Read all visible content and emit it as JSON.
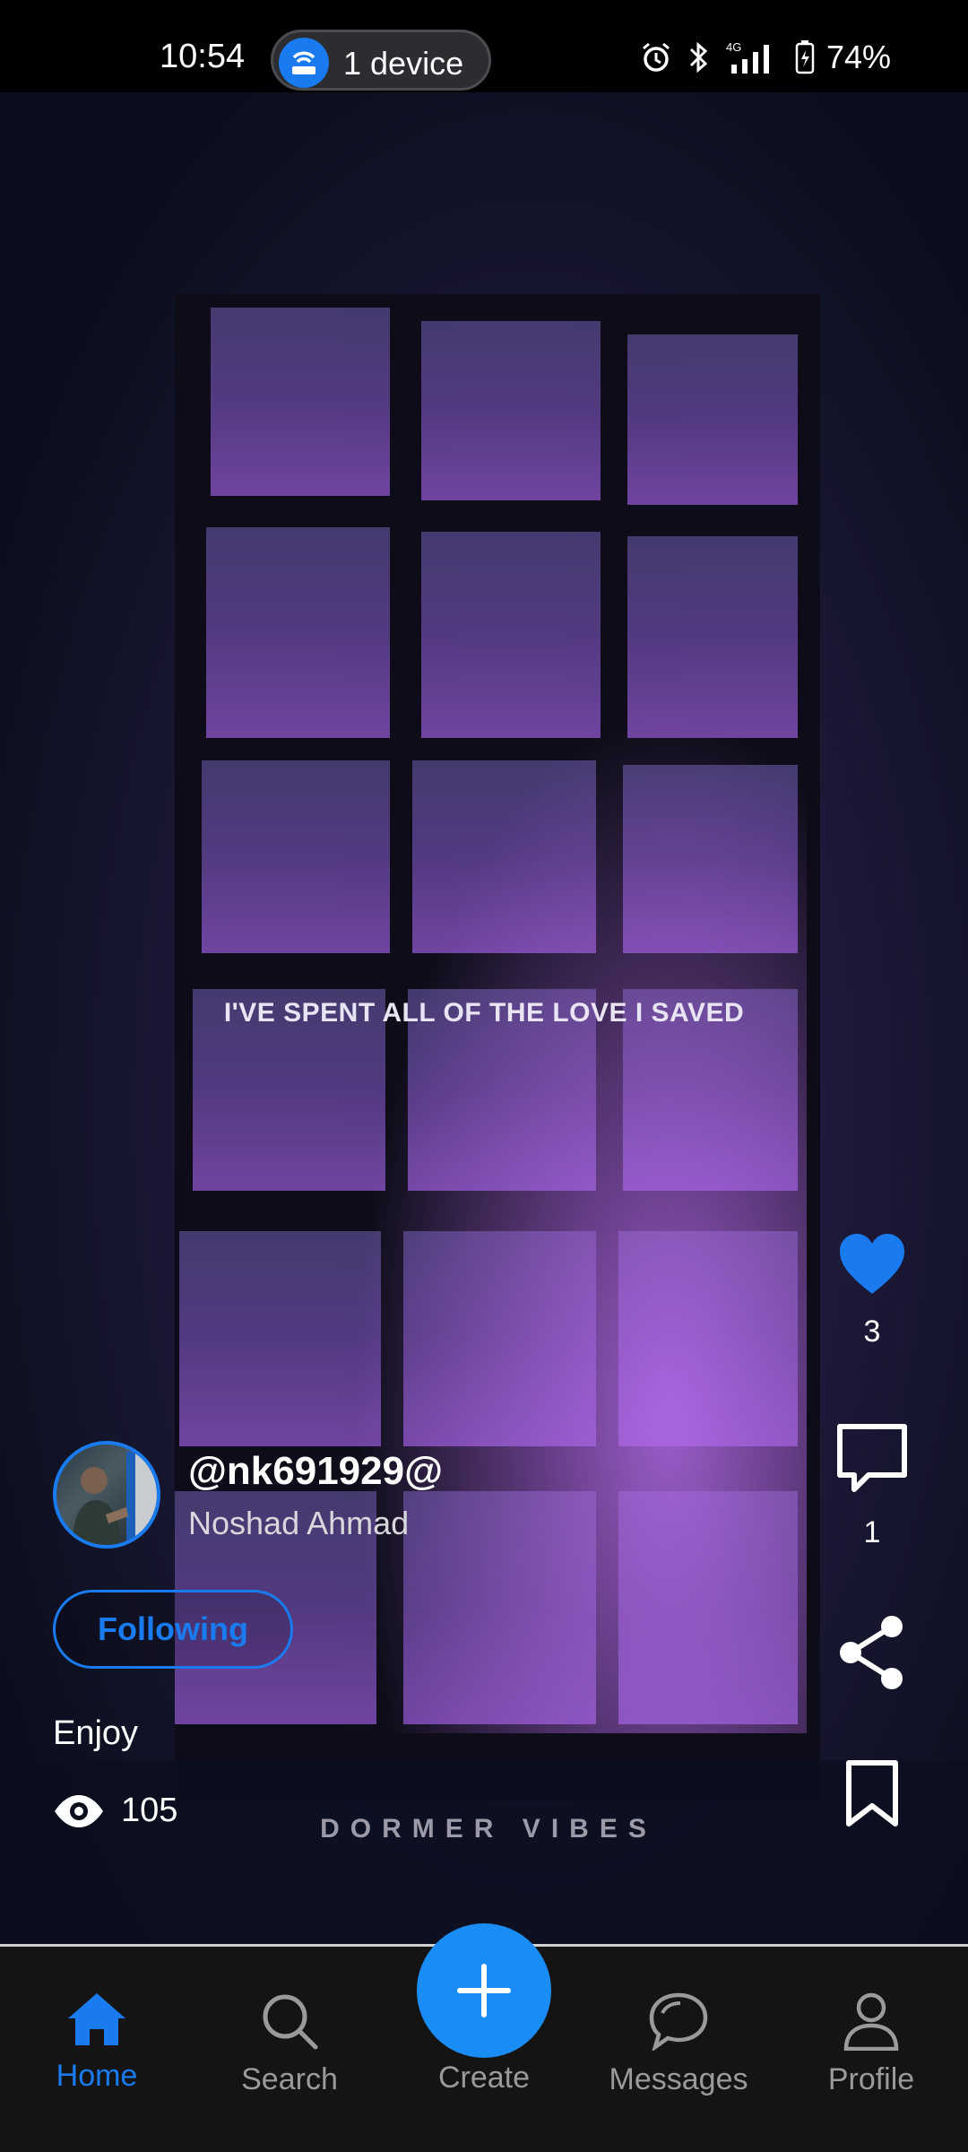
{
  "status_bar": {
    "time": "10:54",
    "pill_label": "1 device",
    "network": "4G",
    "battery": "74%"
  },
  "video": {
    "lyric": "I'VE SPENT ALL OF THE LOVE I SAVED",
    "watermark": "DORMER VIBES"
  },
  "actions": {
    "likes": "3",
    "comments": "1",
    "accent_color": "#1a7bf0"
  },
  "creator": {
    "username": "@nk691929@",
    "name": "Noshad Ahmad",
    "follow_label": "Following"
  },
  "post": {
    "caption": "Enjoy",
    "views": "105"
  },
  "nav": {
    "home": "Home",
    "search": "Search",
    "create": "Create",
    "messages": "Messages",
    "profile": "Profile"
  }
}
